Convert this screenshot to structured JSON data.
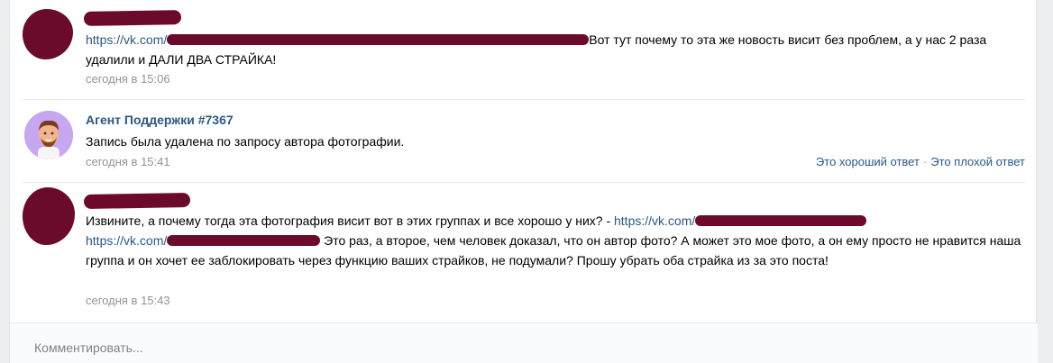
{
  "comments": [
    {
      "author_hidden": true,
      "link_prefix": "https://vk.com/",
      "text": "Вот тут почему то эта же новость висит без проблем, а у нас 2 раза удалили и ДАЛИ ДВА СТРАЙКА!",
      "time": "сегодня в 15:06"
    },
    {
      "author": "Агент Поддержки #7367",
      "text": "Запись была удалена по запросу автора фотографии.",
      "time": "сегодня в 15:41",
      "good_answer": "Это хороший ответ",
      "separator": "·",
      "bad_answer": "Это плохой ответ"
    },
    {
      "author_hidden": true,
      "text_start": "Извините, а почему тогда эта фотография висит вот в этих группах и все хорошо у них? - ",
      "link1_prefix": "https://vk.com/",
      "link2_prefix": "https://vk.com/",
      "text_rest": "Это раз, а второе, чем человек доказал, что он автор фото? А может это мое фото, а он ему просто не нравится наша группа и он хочет ее заблокировать через функцию ваших страйков, не подумали? Прошу убрать оба страйка из за это поста!",
      "time": "сегодня в 15:43"
    }
  ],
  "comment_input": {
    "placeholder": "Комментировать..."
  },
  "colors": {
    "link": "#2a5885",
    "redaction": "#6b0a2b",
    "muted": "#939393"
  }
}
